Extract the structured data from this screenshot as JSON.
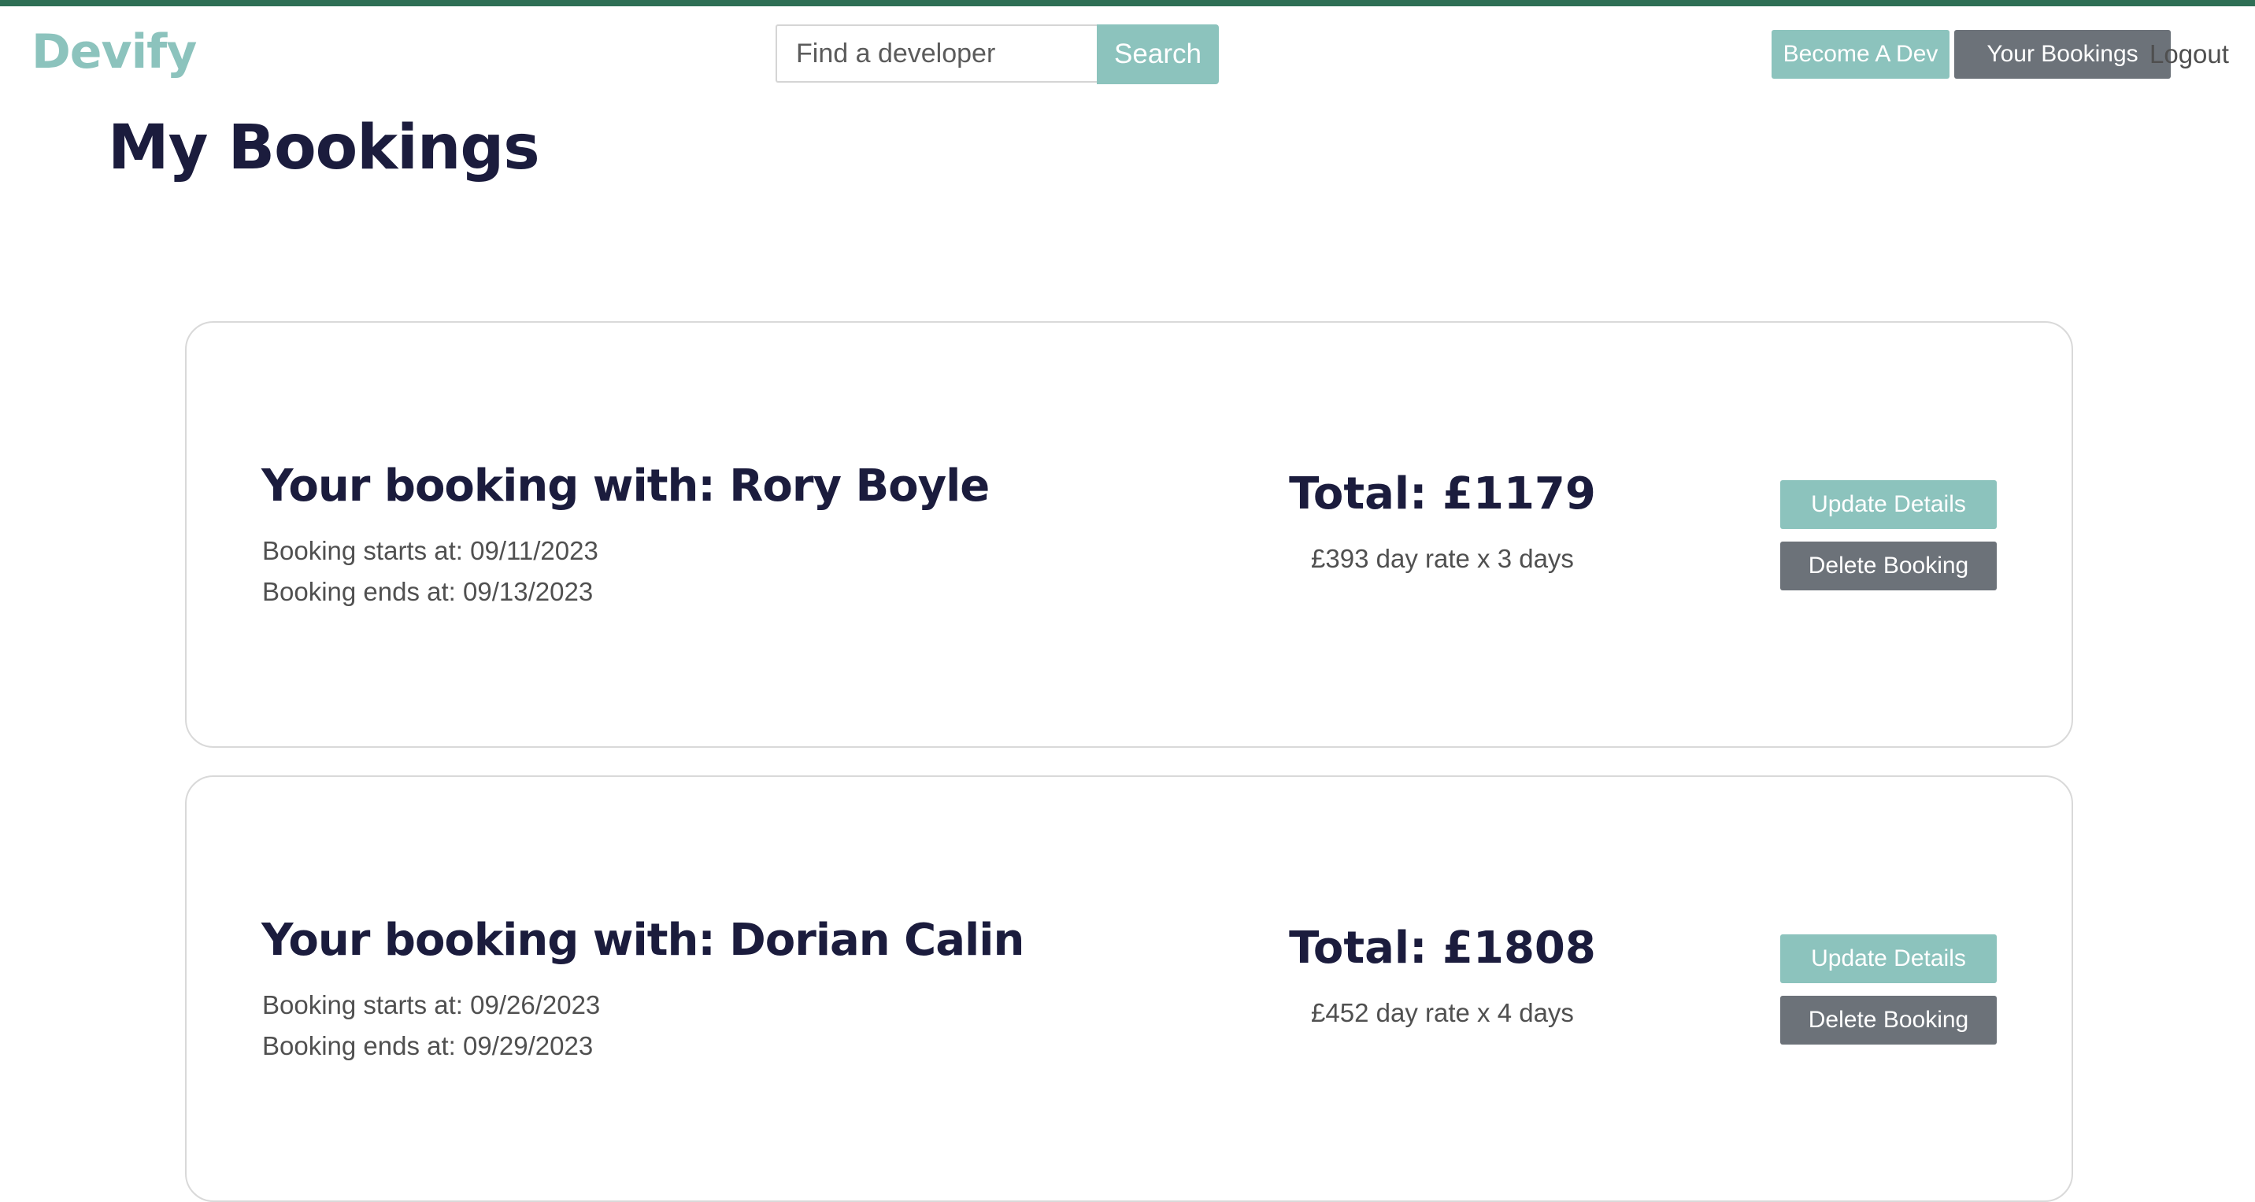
{
  "header": {
    "logo": "Devify",
    "search": {
      "placeholder": "Find a developer",
      "button_label": "Search"
    },
    "nav": {
      "become_dev": "Become A Dev",
      "your_bookings": "Your Bookings",
      "logout": "Logout"
    }
  },
  "page": {
    "title": "My Bookings"
  },
  "bookings": [
    {
      "title": "Your booking with: Rory Boyle",
      "starts": "Booking starts at: 09/11/2023",
      "ends": "Booking ends at: 09/13/2023",
      "total": "Total: £1179",
      "rate": "£393 day rate x 3 days",
      "update_label": "Update Details",
      "delete_label": "Delete Booking"
    },
    {
      "title": "Your booking with: Dorian Calin",
      "starts": "Booking starts at: 09/26/2023",
      "ends": "Booking ends at: 09/29/2023",
      "total": "Total: £1808",
      "rate": "£452 day rate x 4 days",
      "update_label": "Update Details",
      "delete_label": "Delete Booking"
    }
  ],
  "colors": {
    "brand_teal": "#8cc3bd",
    "dark_navy": "#1b1c3d",
    "button_gray": "#6c7279",
    "top_bar_green": "#2f6f55"
  }
}
